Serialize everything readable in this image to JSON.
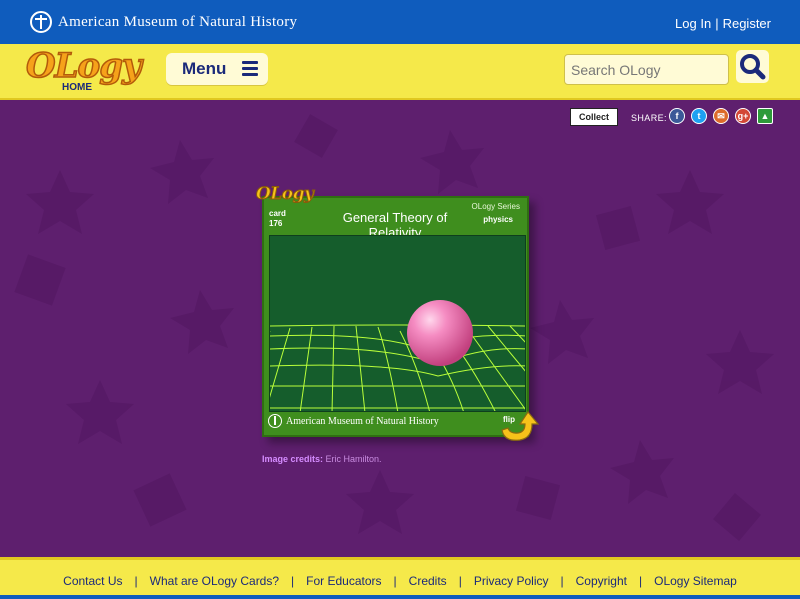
{
  "topbar": {
    "org_name": "American Museum of Natural History",
    "login_label": "Log In",
    "separator": "|",
    "register_label": "Register"
  },
  "header": {
    "logo_text": "OLogy",
    "logo_sub": "HOME",
    "menu_label": "Menu",
    "search_placeholder": "Search OLogy"
  },
  "share": {
    "collect_label": "Collect",
    "share_label": "SHARE:",
    "icons": [
      "facebook-icon",
      "twitter-icon",
      "email-icon",
      "google-plus-icon",
      "classroom-icon"
    ]
  },
  "card": {
    "logo_text": "OLogy",
    "card_word": "card",
    "card_number": "176",
    "series": "OLogy Series",
    "subject": "physics",
    "title": "General Theory of Relativity",
    "footer_org": "American Museum of Natural History",
    "flip_label": "flip"
  },
  "credits": {
    "label": "Image credits:",
    "value": "Eric Hamilton."
  },
  "footer": {
    "links": [
      "Contact Us",
      "What are OLogy Cards?",
      "For Educators",
      "Credits",
      "Privacy Policy",
      "Copyright",
      "OLogy Sitemap"
    ]
  },
  "colors": {
    "topbar_blue": "#0f5cbd",
    "header_yellow": "#f5e94a",
    "background_purple": "#5e1f6e",
    "card_green": "#3f8e1e",
    "sphere_pink": "#f07ab5"
  }
}
